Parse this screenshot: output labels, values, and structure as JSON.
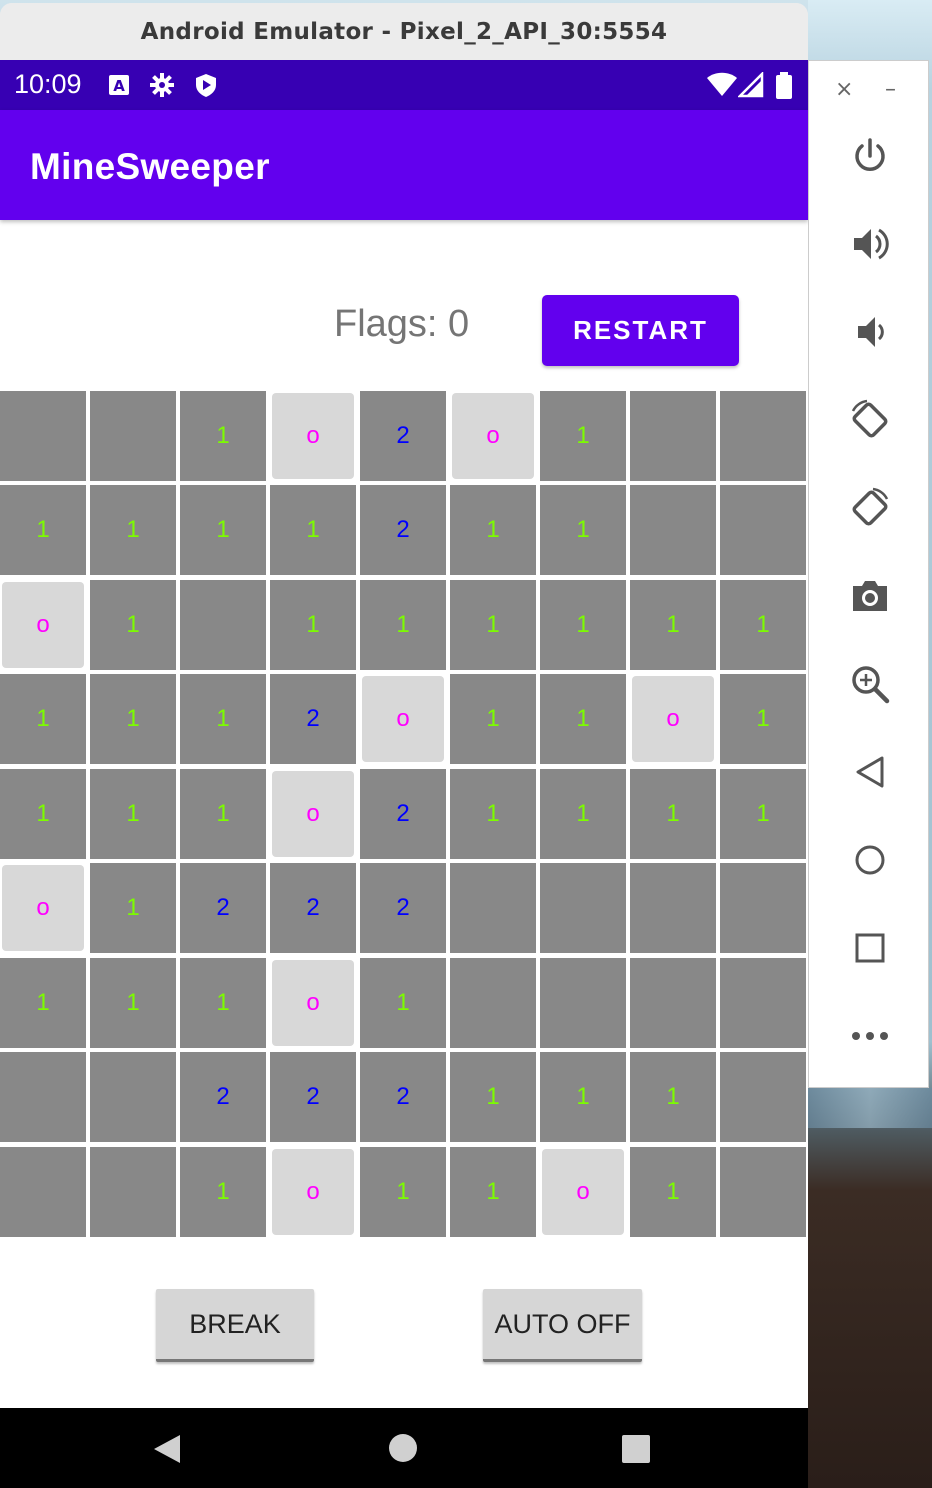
{
  "window": {
    "title": "Android Emulator - Pixel_2_API_30:5554"
  },
  "status_bar": {
    "time": "10:09",
    "left_icons": [
      "a-notification-icon",
      "gear-icon",
      "shield-play-icon"
    ],
    "right_icons": [
      "wifi-icon",
      "signal-icon",
      "battery-icon"
    ]
  },
  "app_bar": {
    "title": "MineSweeper"
  },
  "game": {
    "flags_label": "Flags: 0",
    "restart_label": "RESTART",
    "grid": [
      [
        "",
        "",
        "1",
        "o",
        "2",
        "o",
        "1",
        "",
        ""
      ],
      [
        "1",
        "1",
        "1",
        "1",
        "2",
        "1",
        "1",
        "",
        ""
      ],
      [
        "o",
        "1",
        "",
        "1",
        "1",
        "1",
        "1",
        "1",
        "1"
      ],
      [
        "1",
        "1",
        "1",
        "2",
        "o",
        "1",
        "1",
        "o",
        "1"
      ],
      [
        "1",
        "1",
        "1",
        "o",
        "2",
        "1",
        "1",
        "1",
        "1"
      ],
      [
        "o",
        "1",
        "2",
        "2",
        "2",
        "",
        "",
        "",
        ""
      ],
      [
        "1",
        "1",
        "1",
        "o",
        "1",
        "",
        "",
        "",
        ""
      ],
      [
        "",
        "",
        "2",
        "2",
        "2",
        "1",
        "1",
        "1",
        ""
      ],
      [
        "",
        "",
        "1",
        "o",
        "1",
        "1",
        "o",
        "1",
        ""
      ]
    ],
    "break_label": "BREAK",
    "auto_label": "AUTO OFF"
  },
  "colors": {
    "status_bar": "#3700b3",
    "app_bar": "#6200ee",
    "cell": "#888888",
    "mine_cell": "#d8d8d8",
    "num1": "#7cfc00",
    "num2": "#0000ff",
    "mine_mark": "#ff00ff"
  },
  "nav_bar": {
    "icons": [
      "back-icon",
      "home-icon",
      "overview-icon"
    ]
  },
  "side_toolbar": {
    "top": [
      "close-icon",
      "minimize-icon"
    ],
    "buttons": [
      "power-icon",
      "volume-up-icon",
      "volume-down-icon",
      "rotate-left-icon",
      "rotate-right-icon",
      "camera-icon",
      "zoom-icon",
      "back-icon",
      "home-icon",
      "overview-icon",
      "more-icon"
    ]
  }
}
